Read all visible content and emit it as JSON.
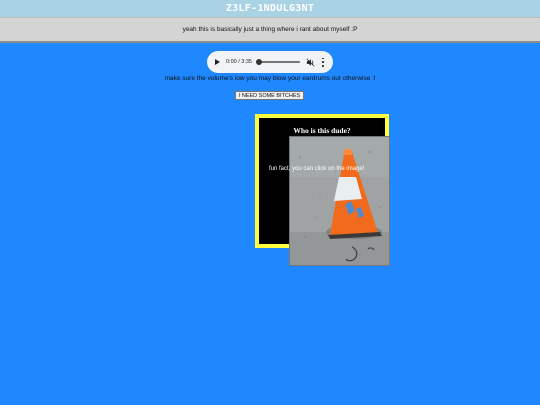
{
  "header": {
    "title": "Z3LF-1NDULG3NT",
    "subtitle": "yeah this is basically just a thing where i rant about myself :P"
  },
  "audio_player": {
    "time_display": "0:00 / 3:35",
    "progress": 0,
    "icons": [
      "play-icon",
      "volume-icon",
      "more-options-icon"
    ]
  },
  "main": {
    "volume_warning": "make sure the volume's low you may blow your eardrums out otherwise :l",
    "button_label": "I NEED SOME BITCHES",
    "box_heading": "Who is this dude?",
    "fun_fact": "fun fact, you can click on the image!"
  },
  "colors": {
    "background": "#1f88ff",
    "title_bar": "#a9d3e4",
    "box_border": "#ffff3d",
    "box_background": "#000000"
  }
}
